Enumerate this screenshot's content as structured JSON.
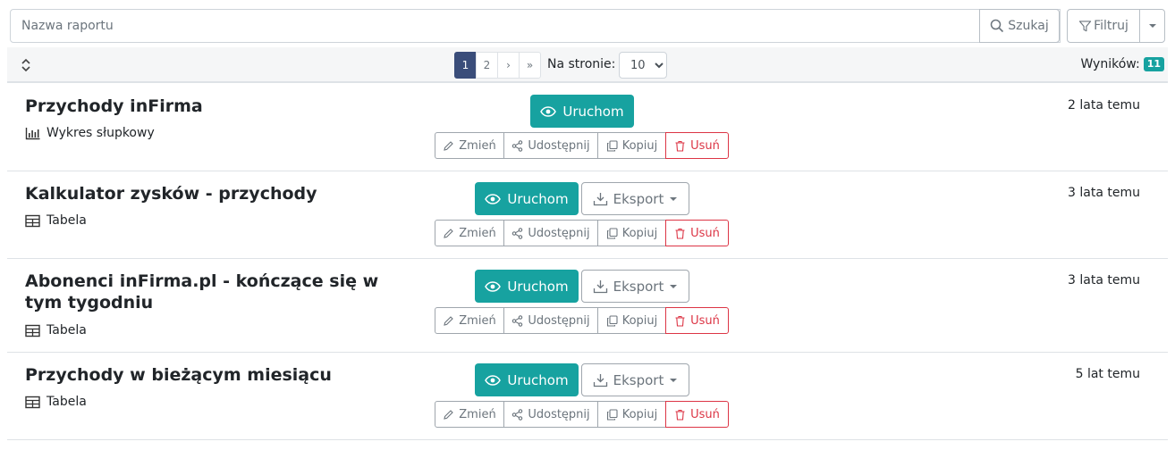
{
  "search": {
    "placeholder": "Nazwa raportu",
    "search_label": "Szukaj",
    "filter_label": "Filtruj"
  },
  "toolbar": {
    "pages": [
      "1",
      "2",
      "›",
      "»"
    ],
    "active_page": "1",
    "per_page_label": "Na stronie:",
    "per_page_value": "10",
    "results_label": "Wyników:",
    "results_count": "11"
  },
  "actions": {
    "run": "Uruchom",
    "export": "Eksport",
    "edit": "Zmień",
    "share": "Udostępnij",
    "copy": "Kopiuj",
    "delete": "Usuń"
  },
  "reports": [
    {
      "title": "Przychody inFirma",
      "type": "Wykres słupkowy",
      "type_icon": "bar-chart-icon",
      "time": "2 lata temu",
      "has_export": false
    },
    {
      "title": "Kalkulator zysków - przychody",
      "type": "Tabela",
      "type_icon": "table-icon",
      "time": "3 lata temu",
      "has_export": true
    },
    {
      "title": "Abonenci inFirma.pl - kończące się w tym tygodniu",
      "type": "Tabela",
      "type_icon": "table-icon",
      "time": "3 lata temu",
      "has_export": true
    },
    {
      "title": "Przychody w bieżącym miesiącu",
      "type": "Tabela",
      "type_icon": "table-icon",
      "time": "5 lat temu",
      "has_export": true
    }
  ],
  "colors": {
    "accent": "#17a2a0",
    "active_page": "#3a4d7a",
    "danger": "#dc3545"
  }
}
